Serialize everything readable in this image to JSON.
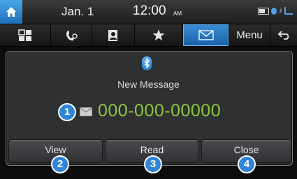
{
  "status_bar": {
    "date": "Jan.  1",
    "time": "12:00",
    "ampm": "AM"
  },
  "toolbar": {
    "menu_label": "Menu",
    "active_tab": "messages"
  },
  "dialog": {
    "title": "New Message",
    "phone_number": "000-000-00000",
    "buttons": {
      "view": "View",
      "read": "Read",
      "close": "Close"
    }
  },
  "callouts": [
    "1",
    "2",
    "3",
    "4"
  ],
  "colors": {
    "accent": "#2f86d6",
    "number_green": "#8cc640",
    "dialog_bg": "#2f3032"
  }
}
